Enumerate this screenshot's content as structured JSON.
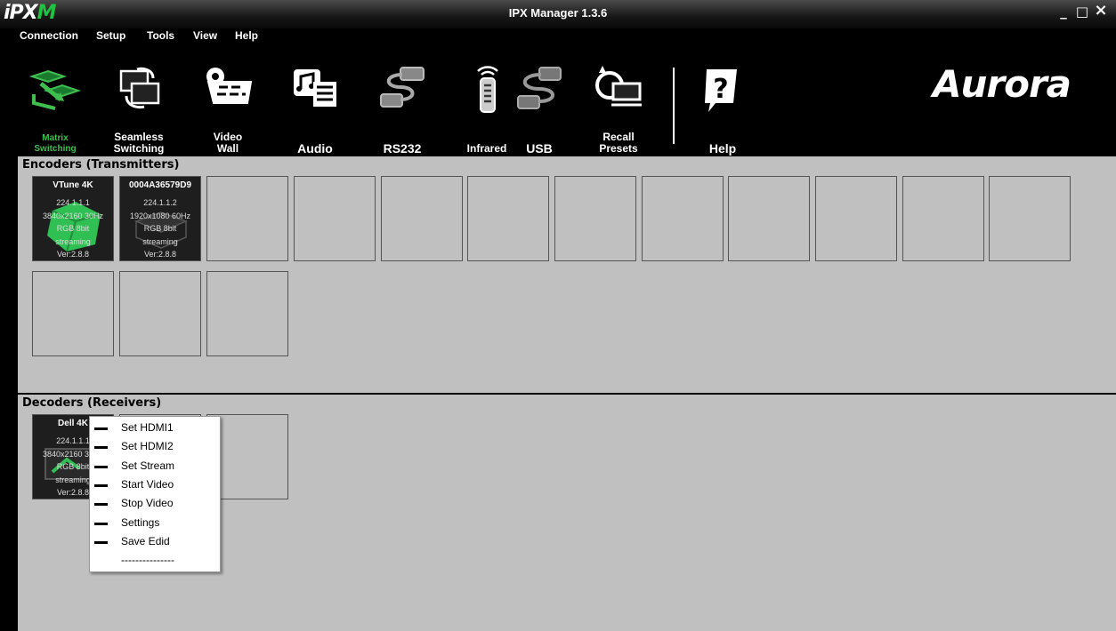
{
  "window": {
    "logo": {
      "prefix": "iPX",
      "suffix": "M"
    },
    "title": "IPX Manager 1.3.6",
    "controls": {
      "minimize": "_",
      "maximize": "□",
      "close": "×"
    }
  },
  "menu": [
    "Connection",
    "Setup",
    "Tools",
    "View",
    "Help"
  ],
  "toolbar": {
    "items": [
      {
        "label": "Matrix\nSwitching",
        "icon": "matrix-switching-icon",
        "active": true
      },
      {
        "label": "Seamless\nSwitching",
        "icon": "seamless-switching-icon"
      },
      {
        "label": "Video\nWall",
        "icon": "video-wall-icon"
      },
      {
        "label": "Audio",
        "icon": "audio-icon"
      },
      {
        "label": "RS232",
        "icon": "rs232-icon"
      },
      {
        "label": "Infrared",
        "icon": "infrared-remote-icon"
      },
      {
        "label": "USB",
        "icon": "usb-icon"
      },
      {
        "label": "Recall\nPresets",
        "icon": "recall-presets-icon"
      }
    ],
    "help": {
      "label": "Help",
      "icon": "help-icon"
    },
    "brand": "Aurora",
    "active_color": "#3fbf4e"
  },
  "encoders": {
    "title": "Encoders (Transmitters)",
    "devices": [
      {
        "name": "VTune 4K",
        "ip": "224.1.1.1",
        "resolution": "3840x2160 30Hz",
        "color": "RGB 8bit",
        "status": "streaming",
        "version": "Ver:2.8.8"
      },
      {
        "name": "0004A36579D9",
        "ip": "224.1.1.2",
        "resolution": "1920x1080 60Hz",
        "color": "RGB 8bit",
        "status": "streaming",
        "version": "Ver:2.8.8"
      }
    ]
  },
  "decoders": {
    "title": "Decoders (Receivers)",
    "devices": [
      {
        "name": "Dell 4K",
        "ip": "224.1.1.1",
        "resolution": "3840x2160 30Hz",
        "color": "RGB 8bit",
        "status": "streaming",
        "version": "Ver:2.8.8"
      }
    ]
  },
  "context_menu": {
    "items": [
      "Set HDMI1",
      "Set HDMI2",
      "Set Stream",
      "Start Video",
      "Stop Video",
      "Settings",
      "Save Edid"
    ],
    "separator": "---------------"
  }
}
